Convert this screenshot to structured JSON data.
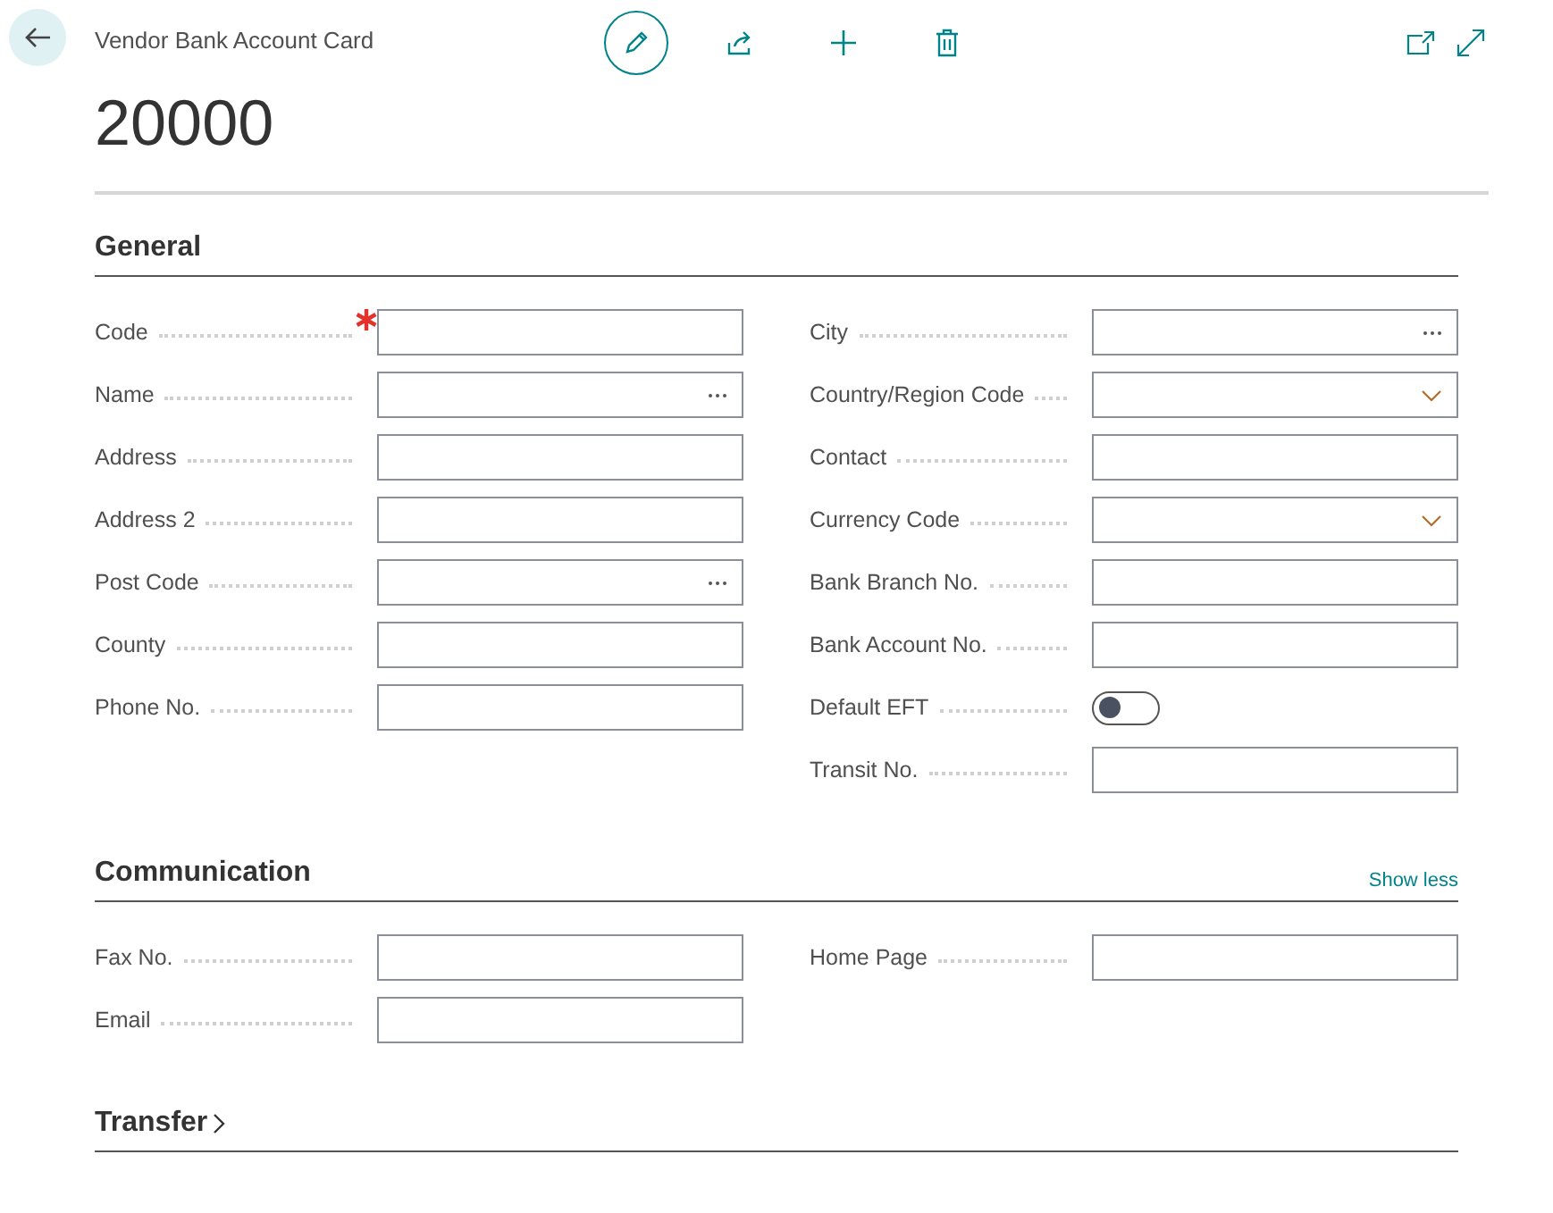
{
  "header": {
    "breadcrumb": "Vendor Bank Account Card",
    "title": "20000"
  },
  "sections": [
    {
      "title": "General",
      "expanded": true,
      "columns": [
        [
          {
            "label": "Code",
            "kind": "text",
            "required": true
          },
          {
            "label": "Name",
            "kind": "lookup",
            "required": false
          },
          {
            "label": "Address",
            "kind": "text",
            "required": false
          },
          {
            "label": "Address 2",
            "kind": "text",
            "required": false
          },
          {
            "label": "Post Code",
            "kind": "lookup",
            "required": false
          },
          {
            "label": "County",
            "kind": "text",
            "required": false
          },
          {
            "label": "Phone No.",
            "kind": "text",
            "required": false
          }
        ],
        [
          {
            "label": "City",
            "kind": "lookup",
            "required": false
          },
          {
            "label": "Country/Region Code",
            "kind": "dropdown",
            "required": false
          },
          {
            "label": "Contact",
            "kind": "text",
            "required": false
          },
          {
            "label": "Currency Code",
            "kind": "dropdown",
            "required": false
          },
          {
            "label": "Bank Branch No.",
            "kind": "text",
            "required": false
          },
          {
            "label": "Bank Account No.",
            "kind": "text",
            "required": false
          },
          {
            "label": "Default EFT",
            "kind": "toggle",
            "on": false,
            "required": false
          },
          {
            "label": "Transit No.",
            "kind": "text",
            "required": false
          }
        ]
      ]
    },
    {
      "title": "Communication",
      "expanded": true,
      "link": "Show less",
      "columns": [
        [
          {
            "label": "Fax No.",
            "kind": "text",
            "required": false
          },
          {
            "label": "Email",
            "kind": "text",
            "required": false
          }
        ],
        [
          {
            "label": "Home Page",
            "kind": "text",
            "required": false
          }
        ]
      ]
    },
    {
      "title": "Transfer",
      "expanded": false
    }
  ]
}
